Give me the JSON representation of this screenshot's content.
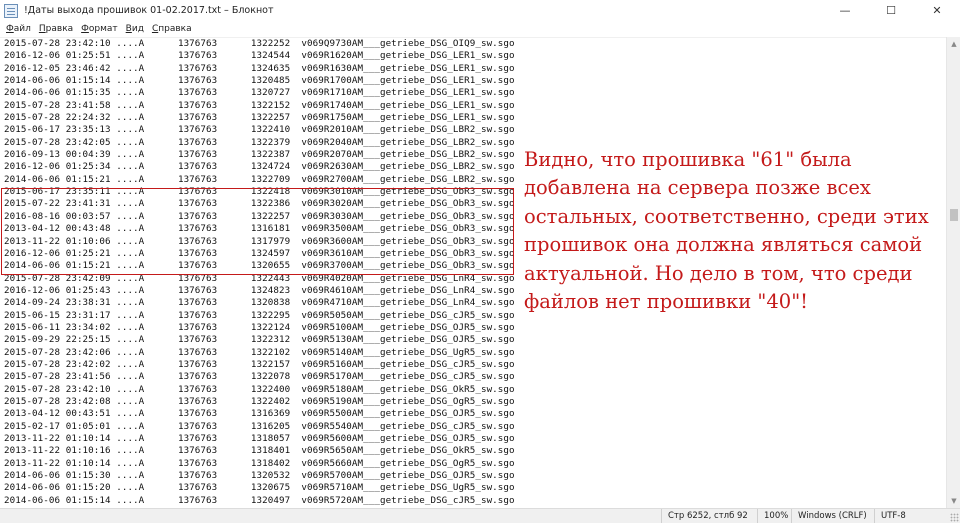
{
  "window": {
    "title": "!Даты выхода прошивок 01-02.2017.txt – Блокнот",
    "minimize_glyph": "—",
    "maximize_glyph": "☐",
    "close_glyph": "✕"
  },
  "menu": [
    {
      "label_u": "Ф",
      "label_rest": "айл"
    },
    {
      "label_u": "П",
      "label_rest": "равка"
    },
    {
      "label_u": "Ф",
      "label_rest": "ормат",
      "prefix": ""
    },
    {
      "label_u": "В",
      "label_rest": "ид"
    },
    {
      "label_u": "С",
      "label_rest": "правка"
    }
  ],
  "lines": [
    "2015-07-28 23:42:10 ....A      1376763      1322252  v069Q9730AM___getriebe_DSG_OIQ9_sw.sgo",
    "2016-12-06 01:25:51 ....A      1376763      1324544  v069R1620AM___getriebe_DSG_LER1_sw.sgo",
    "2016-12-05 23:46:42 ....A      1376763      1324635  v069R1630AM___getriebe_DSG_LER1_sw.sgo",
    "2014-06-06 01:15:14 ....A      1376763      1320485  v069R1700AM___getriebe_DSG_LER1_sw.sgo",
    "2014-06-06 01:15:35 ....A      1376763      1320727  v069R1710AM___getriebe_DSG_LER1_sw.sgo",
    "2015-07-28 23:41:58 ....A      1376763      1322152  v069R1740AM___getriebe_DSG_LER1_sw.sgo",
    "2015-07-28 22:24:32 ....A      1376763      1322257  v069R1750AM___getriebe_DSG_LER1_sw.sgo",
    "2015-06-17 23:35:13 ....A      1376763      1322410  v069R2010AM___getriebe_DSG_LBR2_sw.sgo",
    "2015-07-28 23:42:05 ....A      1376763      1322379  v069R2040AM___getriebe_DSG_LBR2_sw.sgo",
    "2016-09-13 00:04:39 ....A      1376763      1322387  v069R2070AM___getriebe_DSG_LBR2_sw.sgo",
    "2016-12-06 01:25:34 ....A      1376763      1324724  v069R2630AM___getriebe_DSG_LBR2_sw.sgo",
    "2014-06-06 01:15:21 ....A      1376763      1322709  v069R2700AM___getriebe_DSG_LBR2_sw.sgo",
    "2015-06-17 23:35:11 ....A      1376763      1322418  v069R3010AM___getriebe_DSG_ObR3_sw.sgo",
    "2015-07-22 23:41:31 ....A      1376763      1322386  v069R3020AM___getriebe_DSG_ObR3_sw.sgo",
    "2016-08-16 00:03:57 ....A      1376763      1322257  v069R3030AM___getriebe_DSG_ObR3_sw.sgo",
    "2013-04-12 00:43:48 ....A      1376763      1316181  v069R3500AM___getriebe_DSG_ObR3_sw.sgo",
    "2013-11-22 01:10:06 ....A      1376763      1317979  v069R3600AM___getriebe_DSG_ObR3_sw.sgo",
    "2016-12-06 01:25:21 ....A      1376763      1324597  v069R3610AM___getriebe_DSG_ObR3_sw.sgo",
    "2014-06-06 01:15:21 ....A      1376763      1320655  v069R3700AM___getriebe_DSG_ObR3_sw.sgo",
    "2015-07-28 23:42:09 ....A      1376763      1322443  v069R4020AM___getriebe_DSG_LnR4_sw.sgo",
    "2016-12-06 01:25:43 ....A      1376763      1324823  v069R4610AM___getriebe_DSG_LnR4_sw.sgo",
    "2014-09-24 23:38:31 ....A      1376763      1320838  v069R4710AM___getriebe_DSG_LnR4_sw.sgo",
    "2015-06-15 23:31:17 ....A      1376763      1322295  v069R5050AM___getriebe_DSG_cJR5_sw.sgo",
    "2015-06-11 23:34:02 ....A      1376763      1322124  v069R5100AM___getriebe_DSG_OJR5_sw.sgo",
    "2015-09-29 22:25:15 ....A      1376763      1322312  v069R5130AM___getriebe_DSG_OJR5_sw.sgo",
    "2015-07-28 23:42:06 ....A      1376763      1322102  v069R5140AM___getriebe_DSG_UgR5_sw.sgo",
    "2015-07-28 23:42:02 ....A      1376763      1322157  v069R5160AM___getriebe_DSG_cJR5_sw.sgo",
    "2015-07-28 23:41:56 ....A      1376763      1322078  v069R5170AM___getriebe_DSG_cJR5_sw.sgo",
    "2015-07-28 23:42:10 ....A      1376763      1322400  v069R5180AM___getriebe_DSG_OkR5_sw.sgo",
    "2015-07-28 23:42:08 ....A      1376763      1322402  v069R5190AM___getriebe_DSG_OgR5_sw.sgo",
    "2013-04-12 00:43:51 ....A      1376763      1316369  v069R5500AM___getriebe_DSG_OJR5_sw.sgo",
    "2015-02-17 01:05:01 ....A      1376763      1316205  v069R5540AM___getriebe_DSG_cJR5_sw.sgo",
    "2013-11-22 01:10:14 ....A      1376763      1318057  v069R5600AM___getriebe_DSG_OJR5_sw.sgo",
    "2013-11-22 01:10:16 ....A      1376763      1318401  v069R5650AM___getriebe_DSG_OkR5_sw.sgo",
    "2013-11-22 01:10:14 ....A      1376763      1318402  v069R5660AM___getriebe_DSG_OgR5_sw.sgo",
    "2014-06-06 01:15:30 ....A      1376763      1320532  v069R5700AM___getriebe_DSG_OJR5_sw.sgo",
    "2014-06-06 01:15:20 ....A      1376763      1320675  v069R5710AM___getriebe_DSG_UgR5_sw.sgo",
    "2014-06-06 01:15:14 ....A      1376763      1320497  v069R5720AM___getriebe_DSG_cJR5_sw.sgo"
  ],
  "annotation": [
    "Видно, что прошивка \"61\" была",
    "добавлена на сервера позже всех",
    "остальных, соответственно, среди этих",
    "прошивок она должна являться самой",
    "актуальной. Но дело в том, что среди",
    "файлов нет прошивки \"40\"!"
  ],
  "scrollbar": {
    "up_glyph": "▲",
    "down_glyph": "▼"
  },
  "status": {
    "position": "Стр 6252, стлб 92",
    "zoom": "100%",
    "line_endings": "Windows (CRLF)",
    "encoding": "UTF-8"
  },
  "colors": {
    "annotation": "#c41a1a",
    "highlight_border": "#c41a1a"
  }
}
